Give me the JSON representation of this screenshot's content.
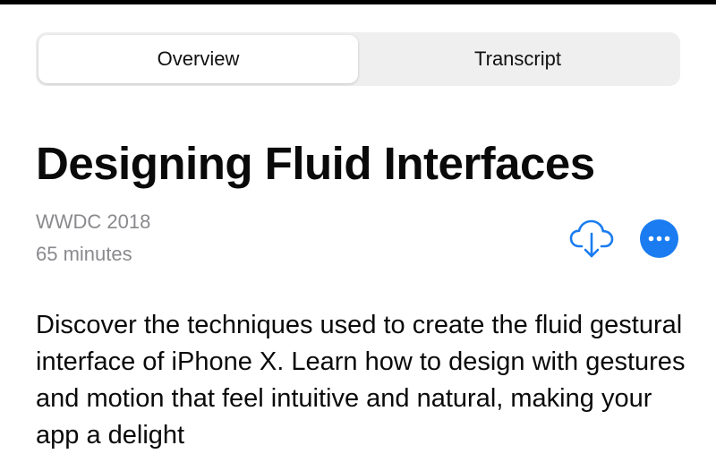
{
  "colors": {
    "accent": "#1a7cf0",
    "secondary_text": "#8a8a8e",
    "segment_bg": "#efeff0"
  },
  "tabs": [
    {
      "label": "Overview",
      "selected": true
    },
    {
      "label": "Transcript",
      "selected": false
    }
  ],
  "session": {
    "title": "Designing Fluid Interfaces",
    "event": "WWDC 2018",
    "duration": "65 minutes",
    "description": "Discover the techniques used to create the fluid gestural interface of iPhone X. Learn how to design with gestures and motion that feel intuitive and natural, making your app a delight"
  },
  "actions": {
    "download_icon": "cloud-download-icon",
    "more_icon": "more-icon"
  }
}
